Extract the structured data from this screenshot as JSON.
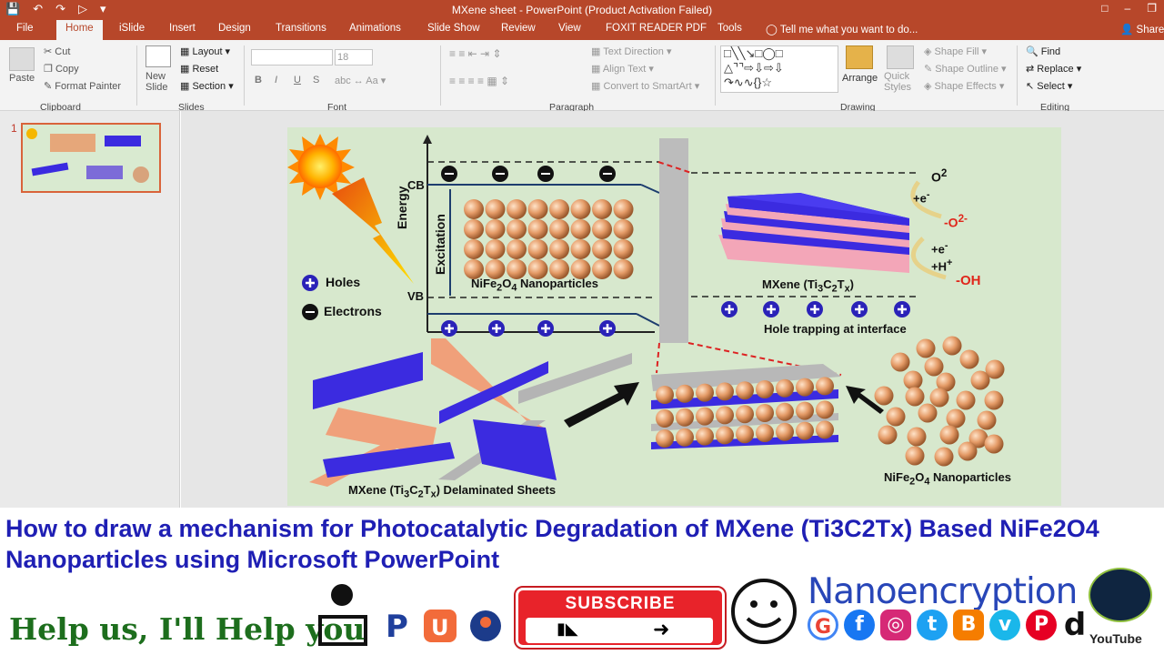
{
  "window": {
    "title": "MXene sheet - PowerPoint (Product Activation Failed)",
    "share": "Share"
  },
  "tabs": [
    "File",
    "Home",
    "iSlide",
    "Insert",
    "Design",
    "Transitions",
    "Animations",
    "Slide Show",
    "Review",
    "View",
    "FOXIT READER PDF",
    "Tools"
  ],
  "tell_me": "Tell me what you want to do...",
  "clipboard": {
    "paste": "Paste",
    "cut": "Cut",
    "copy": "Copy",
    "format_painter": "Format Painter",
    "group": "Clipboard"
  },
  "slides": {
    "new_slide": "New Slide",
    "layout": "Layout",
    "reset": "Reset",
    "section": "Section",
    "group": "Slides"
  },
  "font": {
    "size": "18",
    "bold": "B",
    "italic": "I",
    "underline": "U",
    "strike": "S",
    "group": "Font"
  },
  "paragraph": {
    "text_direction": "Text Direction",
    "align_text": "Align Text",
    "smartart": "Convert to SmartArt",
    "group": "Paragraph"
  },
  "drawing": {
    "arrange": "Arrange",
    "quick_styles": "Quick Styles",
    "shape_fill": "Shape Fill",
    "shape_outline": "Shape Outline",
    "shape_effects": "Shape Effects",
    "group": "Drawing"
  },
  "editing": {
    "find": "Find",
    "replace": "Replace",
    "select": "Select",
    "group": "Editing"
  },
  "thumbnail_number": "1",
  "diagram": {
    "cb": "CB",
    "vb": "VB",
    "energy": "Energy",
    "excitation": "Excitation",
    "holes": "Holes",
    "electrons": "Electrons",
    "nife_label_html": "NiFe<sub>2</sub>O<sub>4</sub> Nanoparticles",
    "mxene_label_html": "MXene (Ti<sub>3</sub>C<sub>2</sub>T<sub>x</sub>)",
    "hole_trapping": "Hole trapping at interface",
    "o2_html": "O<sup>2</sup>",
    "e1_html": "+e<sup>-</sup>",
    "o2minus_html": "-O<sup>2-</sup>",
    "e2_html": "+e<sup>-</sup>",
    "h_html": "+H<sup>+</sup>",
    "oh": "-OH",
    "delaminated_html": "MXene (Ti<sub>3</sub>C<sub>2</sub>T<sub>x</sub>) Delaminated Sheets",
    "nife_bottom_html": "NiFe<sub>2</sub>O<sub>4</sub> Nanoparticles"
  },
  "banner": {
    "title": "How to draw a mechanism for Photocatalytic Degradation of MXene (Ti3C2Tx) Based NiFe2O4 Nanoparticles using Microsoft PowerPoint",
    "help": "Help us, I'll Help you",
    "subscribe": "SUBSCRIBE",
    "brand": "Nanoencryption",
    "youtube": "YouTube"
  }
}
